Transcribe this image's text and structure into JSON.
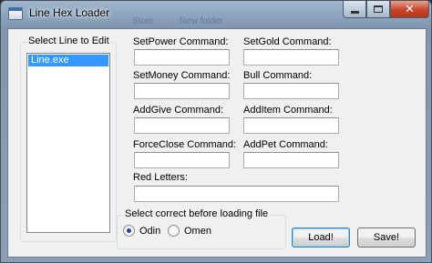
{
  "window": {
    "title": "Line Hex Loader",
    "background_text": [
      "Store",
      "New folder"
    ]
  },
  "list": {
    "title": "Select Line to Edit",
    "items": [
      "Line.exe"
    ],
    "selected": "Line.exe"
  },
  "fields": [
    {
      "label": "SetPower Command:",
      "value": ""
    },
    {
      "label": "SetGold Command:",
      "value": ""
    },
    {
      "label": "SetMoney Command:",
      "value": ""
    },
    {
      "label": "Bull Command:",
      "value": ""
    },
    {
      "label": "AddGive Command:",
      "value": ""
    },
    {
      "label": "AddItem Command:",
      "value": ""
    },
    {
      "label": "ForceClose Command:",
      "value": ""
    },
    {
      "label": "AddPet Command:",
      "value": ""
    },
    {
      "label": "Red Letters:",
      "value": ""
    }
  ],
  "loader": {
    "title": "Select correct before loading file",
    "options": [
      "Odin",
      "Omen"
    ],
    "selected": "Odin"
  },
  "buttons": {
    "load": "Load!",
    "save": "Save!"
  },
  "colors": {
    "selection": "#3399ff",
    "close_button": "#c8432a",
    "radio_dot": "#1f4aa8"
  }
}
